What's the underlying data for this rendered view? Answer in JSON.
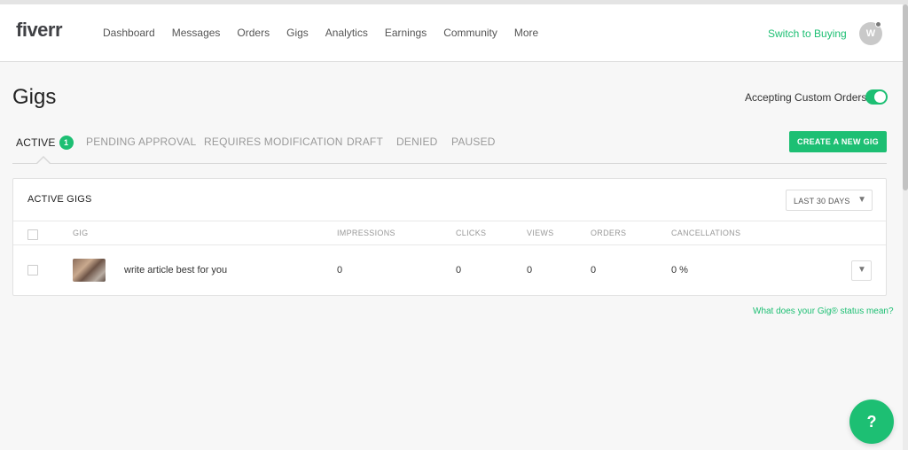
{
  "header": {
    "logo": "fiverr",
    "nav": [
      "Dashboard",
      "Messages",
      "Orders",
      "Gigs",
      "Analytics",
      "Earnings",
      "Community",
      "More"
    ],
    "switch_link": "Switch to Buying",
    "avatar_initial": "W"
  },
  "page": {
    "title": "Gigs",
    "custom_orders_label": "Accepting Custom Orders",
    "custom_orders_enabled": true
  },
  "tabs": {
    "active": "ACTIVE",
    "active_count": "1",
    "pending": "PENDING APPROVAL",
    "requires_mod": "REQUIRES MODIFICATION",
    "draft": "DRAFT",
    "denied": "DENIED",
    "paused": "PAUSED"
  },
  "create_button": "CREATE A NEW GIG",
  "gigs_table": {
    "title": "ACTIVE GIGS",
    "period": "LAST 30 DAYS",
    "columns": [
      "GIG",
      "IMPRESSIONS",
      "CLICKS",
      "VIEWS",
      "ORDERS",
      "CANCELLATIONS"
    ],
    "rows": [
      {
        "title": "write article best for you",
        "impressions": "0",
        "clicks": "0",
        "views": "0",
        "orders": "0",
        "cancellations": "0 %"
      }
    ]
  },
  "status_link": "What does your Gig® status mean?",
  "help_button": "?",
  "icons": {
    "dropdown": "chevron-down-icon",
    "help": "help-icon"
  },
  "colors": {
    "brand": "#1dbf73",
    "background": "#f7f7f7"
  }
}
